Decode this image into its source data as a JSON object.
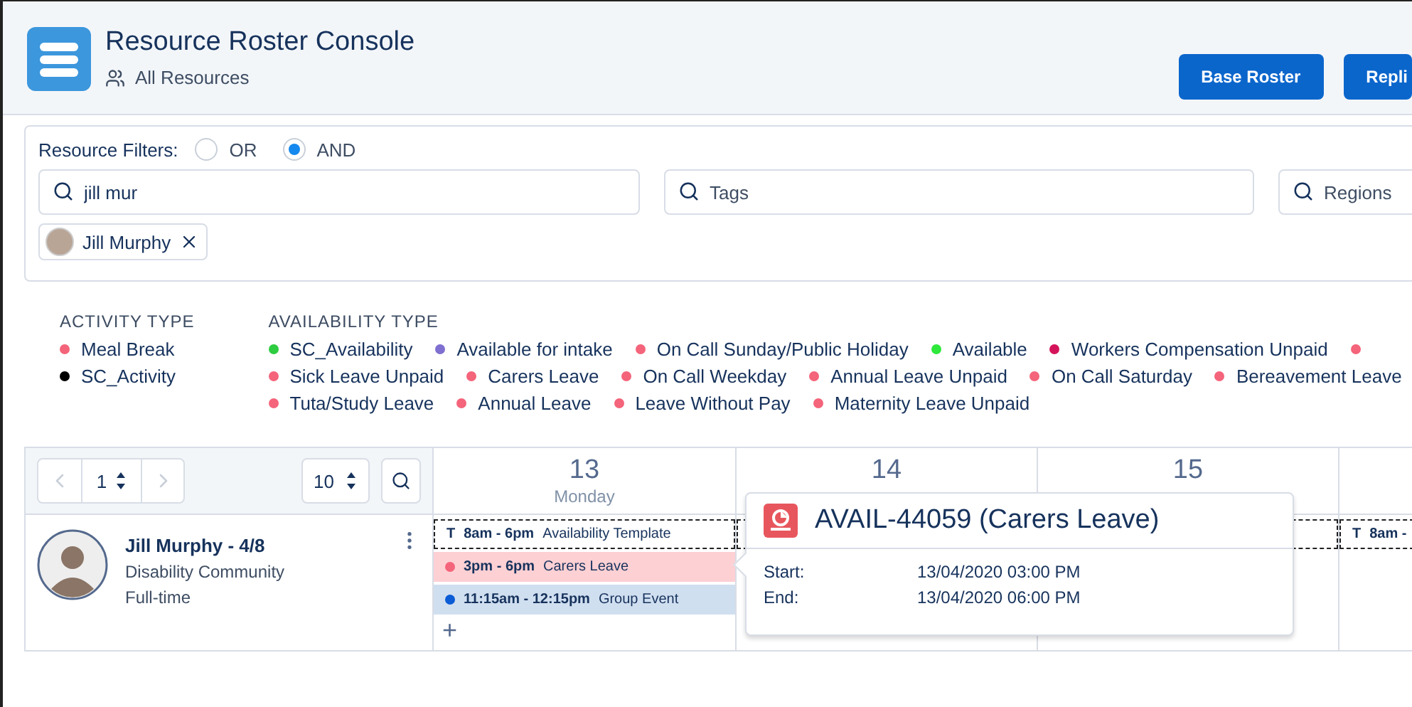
{
  "app": {
    "title": "Resource Roster Console",
    "subtitle": "All Resources"
  },
  "header_buttons": [
    {
      "label": "Base Roster"
    },
    {
      "label": "Repli"
    }
  ],
  "filters": {
    "label": "Resource Filters:",
    "modes": [
      {
        "label": "OR",
        "selected": false
      },
      {
        "label": "AND",
        "selected": true
      }
    ],
    "fields": [
      {
        "value": "jill mur"
      },
      {
        "placeholder": "Tags"
      },
      {
        "placeholder": "Regions"
      }
    ],
    "chips": [
      {
        "label": "Jill Murphy"
      }
    ]
  },
  "legend": {
    "activity": {
      "title": "ACTIVITY TYPE",
      "items": [
        {
          "label": "Meal Break",
          "color": "#f4647a"
        },
        {
          "label": "SC_Activity",
          "color": "#000000"
        }
      ]
    },
    "availability": {
      "title": "AVAILABILITY TYPE",
      "rows": [
        [
          {
            "label": "SC_Availability",
            "color": "#2ecc40"
          },
          {
            "label": "Available for intake",
            "color": "#7f6fd0"
          },
          {
            "label": "On Call Sunday/Public Holiday",
            "color": "#f4647a"
          },
          {
            "label": "Available",
            "color": "#2ee83c"
          },
          {
            "label": "Workers Compensation Unpaid",
            "color": "#d4145a"
          },
          {
            "color": "#f4647a"
          }
        ],
        [
          {
            "label": "Sick Leave Unpaid",
            "color": "#f4647a"
          },
          {
            "label": "Carers Leave",
            "color": "#f4647a"
          },
          {
            "label": "On Call Weekday",
            "color": "#f4647a"
          },
          {
            "label": "Annual Leave Unpaid",
            "color": "#f4647a"
          },
          {
            "label": "On Call Saturday",
            "color": "#f4647a"
          },
          {
            "label": "Bereavement Leave",
            "color": "#f4647a"
          }
        ],
        [
          {
            "label": "Tuta/Study Leave",
            "color": "#f4647a"
          },
          {
            "label": "Annual Leave",
            "color": "#f4647a"
          },
          {
            "label": "Leave Without Pay",
            "color": "#f4647a"
          },
          {
            "label": "Maternity Leave Unpaid",
            "color": "#f4647a"
          }
        ]
      ]
    }
  },
  "roster": {
    "page": "1",
    "page_size": "10",
    "resources": [
      {
        "name": "Jill Murphy - 4/8",
        "team": "Disability Community",
        "employment": "Full-time"
      }
    ],
    "days": [
      {
        "date": "13",
        "weekday": "Monday",
        "add": "+",
        "entries": [
          {
            "kind": "template",
            "badge": "T",
            "time": "8am - 6pm",
            "label": "Availability Template"
          },
          {
            "kind": "availability",
            "time": "3pm - 6pm",
            "label": "Carers Leave",
            "color": "#f4647a"
          },
          {
            "kind": "event",
            "time": "11:15am - 12:15pm",
            "label": "Group Event",
            "color": "#0b5cd5"
          }
        ]
      },
      {
        "date": "14",
        "entries": [
          {
            "kind": "template"
          }
        ]
      },
      {
        "date": "15",
        "entries": [
          {
            "kind": "template"
          }
        ]
      },
      {
        "entries": [
          {
            "kind": "template",
            "badge": "T",
            "time": "8am -"
          }
        ]
      }
    ]
  },
  "popover": {
    "title": "AVAIL-44059 (Carers Leave)",
    "fields": [
      {
        "label": "Start:",
        "value": "13/04/2020 03:00 PM"
      },
      {
        "label": "End:",
        "value": "13/04/2020 06:00 PM"
      }
    ]
  }
}
